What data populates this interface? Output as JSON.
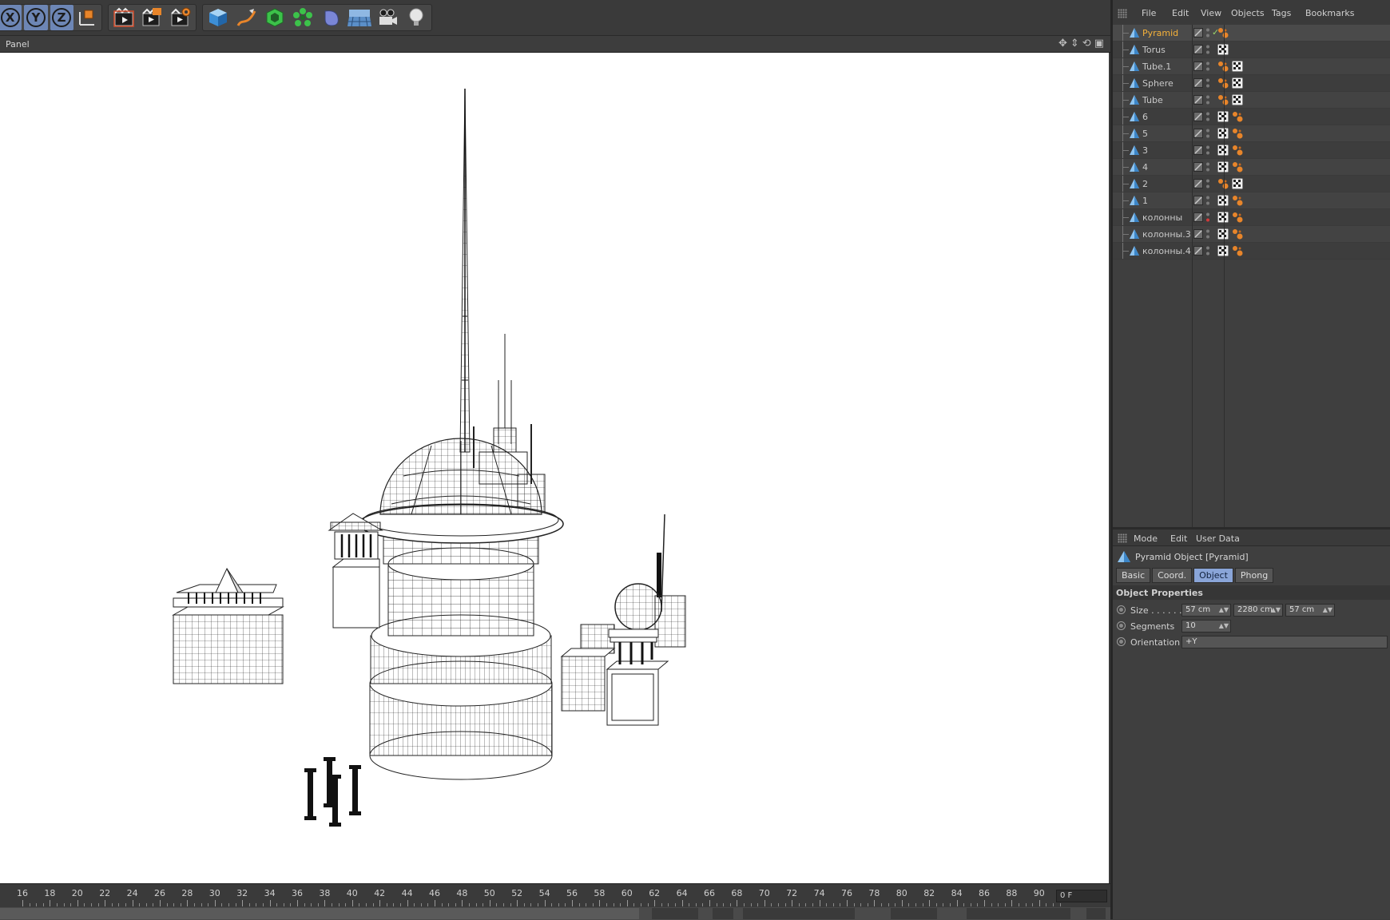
{
  "toolbar": {
    "axis_buttons": [
      "X",
      "Y",
      "Z"
    ],
    "groups": [
      {
        "name": "axis",
        "icons": [
          "x-axis-lock-icon",
          "y-axis-lock-icon",
          "z-axis-lock-icon",
          "coordinate-system-icon"
        ]
      },
      {
        "name": "render",
        "icons": [
          "render-view-icon",
          "render-picture-viewer-icon",
          "render-settings-icon"
        ]
      },
      {
        "name": "create",
        "icons": [
          "cube-primitive-icon",
          "pen-spline-icon",
          "subdivision-icon",
          "cloner-icon",
          "deformer-icon",
          "floor-icon",
          "camera-icon",
          "light-icon"
        ]
      }
    ]
  },
  "viewport": {
    "title": "Panel",
    "nav_icons": [
      "move-view-icon",
      "zoom-view-icon",
      "rotate-view-icon",
      "maximize-view-icon"
    ]
  },
  "timeline": {
    "ticks": [
      "16",
      "18",
      "20",
      "22",
      "24",
      "26",
      "28",
      "30",
      "32",
      "34",
      "36",
      "38",
      "40",
      "42",
      "44",
      "46",
      "48",
      "50",
      "52",
      "54",
      "56",
      "58",
      "60",
      "62",
      "64",
      "66",
      "68",
      "70",
      "72",
      "74",
      "76",
      "78",
      "80",
      "82",
      "84",
      "86",
      "88",
      "90"
    ],
    "current_frame": "0 F"
  },
  "object_manager": {
    "menu": [
      "File",
      "Edit",
      "View",
      "Objects",
      "Tags",
      "Bookmarks"
    ],
    "objects": [
      {
        "name": "Pyramid",
        "selected": true,
        "check": "✓",
        "tags": [
          "material"
        ]
      },
      {
        "name": "Torus",
        "tags": [
          "texture"
        ]
      },
      {
        "name": "Tube.1",
        "tags": [
          "material",
          "texture"
        ]
      },
      {
        "name": "Sphere",
        "tags": [
          "material",
          "texture"
        ]
      },
      {
        "name": "Tube",
        "tags": [
          "material",
          "texture"
        ]
      },
      {
        "name": "6",
        "tags": [
          "texture",
          "material"
        ]
      },
      {
        "name": "5",
        "tags": [
          "texture",
          "material"
        ]
      },
      {
        "name": "3",
        "tags": [
          "texture",
          "material"
        ]
      },
      {
        "name": "4",
        "tags": [
          "texture",
          "material"
        ]
      },
      {
        "name": "2",
        "tags": [
          "material",
          "texture"
        ]
      },
      {
        "name": "1",
        "tags": [
          "texture",
          "material"
        ]
      },
      {
        "name": "колонны",
        "tags": [
          "texture",
          "material"
        ],
        "dot_red": true
      },
      {
        "name": "колонны.3",
        "tags": [
          "texture",
          "material"
        ]
      },
      {
        "name": "колонны.4",
        "tags": [
          "texture",
          "material"
        ]
      }
    ]
  },
  "attribute_manager": {
    "menu": [
      "Mode",
      "Edit",
      "User Data"
    ],
    "title": "Pyramid Object [Pyramid]",
    "tabs": [
      "Basic",
      "Coord.",
      "Object",
      "Phong"
    ],
    "active_tab": "Object",
    "section": "Object Properties",
    "size_label": "Size . . . . . . .",
    "size_x": "57 cm",
    "size_y": "2280 cm",
    "size_z": "57 cm",
    "segments_label": "Segments",
    "segments": "10",
    "orientation_label": "Orientation",
    "orientation": "+Y"
  },
  "colors": {
    "selected_object": "#f6b23a",
    "active_tab": "#8aa5d8",
    "viewport_bg": "#ffffff"
  }
}
